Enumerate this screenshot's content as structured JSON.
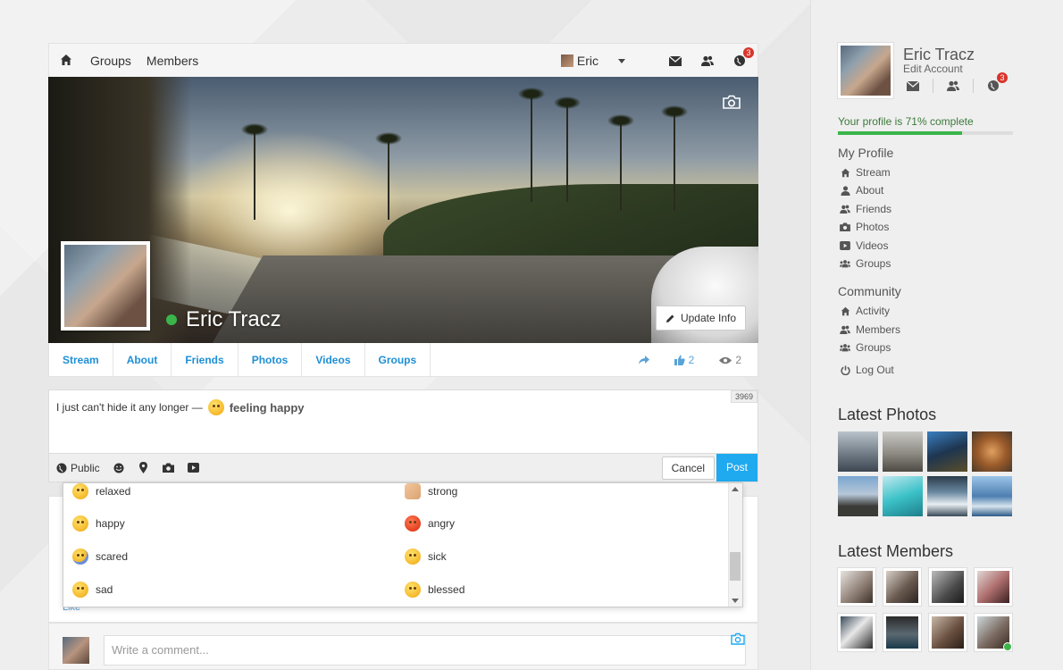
{
  "topnav": {
    "links": [
      "Groups",
      "Members"
    ],
    "user": "Eric",
    "notification_count": "3"
  },
  "cover": {
    "name": "Eric Tracz",
    "update_button": "Update Info"
  },
  "tabs": [
    "Stream",
    "About",
    "Friends",
    "Photos",
    "Videos",
    "Groups"
  ],
  "stats": {
    "likes": "2",
    "views": "2"
  },
  "composer": {
    "text": "I just can't hide it any longer —",
    "feeling": "feeling happy",
    "char_count": "3969",
    "privacy": "Public",
    "cancel": "Cancel",
    "post": "Post"
  },
  "feelings": [
    {
      "label": "relaxed",
      "icon": "relaxed-emoji-icon",
      "style": "yellow"
    },
    {
      "label": "strong",
      "icon": "flexed-biceps-emoji-icon",
      "style": "arm"
    },
    {
      "label": "happy",
      "icon": "happy-emoji-icon",
      "style": "yellow"
    },
    {
      "label": "angry",
      "icon": "angry-emoji-icon",
      "style": "red"
    },
    {
      "label": "scared",
      "icon": "scared-emoji-icon",
      "style": "blue"
    },
    {
      "label": "sick",
      "icon": "sick-emoji-icon",
      "style": "yellow"
    },
    {
      "label": "sad",
      "icon": "sad-emoji-icon",
      "style": "yellow"
    },
    {
      "label": "blessed",
      "icon": "blessed-emoji-icon",
      "style": "yellow"
    }
  ],
  "post": {
    "like": "Like"
  },
  "comment": {
    "placeholder": "Write a comment..."
  },
  "sidebar": {
    "name": "Eric Tracz",
    "edit_account": "Edit Account",
    "notification_count": "3",
    "progress_text": "Your profile is 71% complete",
    "progress_value": 71,
    "my_profile_title": "My Profile",
    "my_profile": [
      {
        "label": "Stream",
        "icon": "home-icon"
      },
      {
        "label": "About",
        "icon": "user-icon"
      },
      {
        "label": "Friends",
        "icon": "friends-icon"
      },
      {
        "label": "Photos",
        "icon": "camera-icon"
      },
      {
        "label": "Videos",
        "icon": "video-icon"
      },
      {
        "label": "Groups",
        "icon": "groups-icon"
      }
    ],
    "community_title": "Community",
    "community": [
      {
        "label": "Activity",
        "icon": "home-icon"
      },
      {
        "label": "Members",
        "icon": "members-icon"
      },
      {
        "label": "Groups",
        "icon": "groups-icon"
      }
    ],
    "logout": "Log Out",
    "latest_photos_title": "Latest Photos",
    "latest_members_title": "Latest Members"
  },
  "colors": {
    "accent": "#1fa9ef",
    "tab_text": "#1e8fd6",
    "online": "#3bb54a",
    "badge": "#d9342b"
  }
}
